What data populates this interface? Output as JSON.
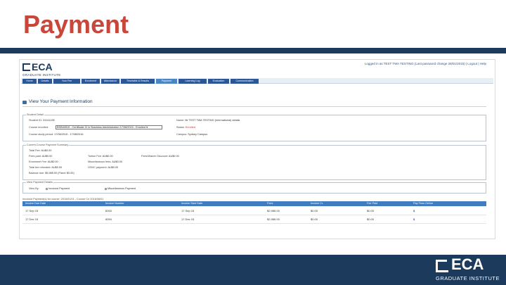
{
  "slide": {
    "title": "Payment",
    "logo_text": "ECA",
    "logo_sub": "GRADUATE INSTITUTE"
  },
  "app": {
    "logo_text": "ECA",
    "logo_sub": "GRADUATE INSTITUTE",
    "user_line": "Logged in as TEST TWA TESTING (Last password change 28/01/2015)  |  Logout  |  Help",
    "nav_tabs": [
      "Home",
      "Details",
      "Your Fee",
      "Enrolment",
      "Attendance",
      "Timetable & Results",
      "Payment",
      "Learning Log",
      "Evaluation",
      "Communication"
    ],
    "active_tab": "Payment",
    "page_title": "View Your Payment Information",
    "student_detail": {
      "legend": "Student Detail",
      "student_id_label": "Student ID:",
      "student_id": "24141195",
      "course_label": "Course enrolled:",
      "course_value": "BSB40515 - Certificate IV in Business Administration 17/08/2015 - Enrolled",
      "course_period_label": "Course study period:",
      "course_period": "17/08/2015 - 17/08/2016",
      "name_label": "Name:",
      "name": "Mr TEST TWA TESTING (International) details",
      "status_label": "Status:",
      "status": "Enrolled",
      "campus_label": "Campus:",
      "campus": "Sydney Campus"
    },
    "current_course": {
      "legend": "Current Course Payment Summary",
      "total_fee_label": "Total Fee:",
      "total_fee": "AU$0.00",
      "fees_paid_label": "Fees paid:",
      "fees_paid": "AU$0.00",
      "tuition_fee_label": "Tuition Fee:",
      "tuition_fee": "AU$0.00",
      "fee_waiver_label": "Fees/Waiver Discount:",
      "fee_waiver": "AU$0.00",
      "enrol_fee_label": "Enrolment Fee:",
      "enrol_fee": "AU$0.00",
      "misc_label": "Miscellaneous fees:",
      "misc": "AU$0.00",
      "refund_label": "Total fee refunded:",
      "refund": "AU$0.00",
      "osc_label": "OSHC payment:",
      "osc": "AU$0.00",
      "balance_label": "Balance due:",
      "balance": "$5,985.00 (Fixed: $0.00)"
    },
    "view_payment": {
      "legend": "View Payment Details",
      "view_by_label": "View By:",
      "option_1": "Invoiced Payment",
      "option_2": "Miscellaneous Payment"
    },
    "table": {
      "title": "Invoiced Payment(s) for course: 2015/01/01 - Course Cn 2016/08/01",
      "columns": [
        "Invoice Due Date",
        "Invoice Number",
        "Invoice Start Date",
        "Fees",
        "Invoice Cr.",
        "Fee Paid",
        "Pay Fees Online"
      ],
      "rows": [
        [
          "17 Sep 15",
          "8393",
          "17 Sep 15",
          "$2,985.00",
          "$0.00",
          "$0.00",
          "$"
        ],
        [
          "17 Dec 15",
          "8394",
          "17 Dec 15",
          "$2,985.00",
          "$0.00",
          "$0.00",
          "$"
        ]
      ]
    }
  }
}
